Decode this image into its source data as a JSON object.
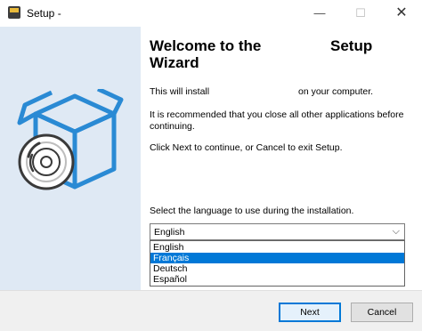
{
  "window": {
    "title": "Setup -",
    "minimize_glyph": "—",
    "maximize_glyph": "☐",
    "close_glyph": "✕"
  },
  "wizard": {
    "heading_part1": "Welcome to the",
    "heading_part2": "Setup",
    "heading_part3": "Wizard",
    "install_before": "This will install",
    "install_after": "on your computer.",
    "recommend": "It is recommended that you close all other applications before continuing.",
    "continue_text": "Click Next to continue, or Cancel to exit Setup.",
    "language_prompt": "Select the language to use during the installation."
  },
  "language": {
    "selected_value": "English",
    "options": [
      "English",
      "Français",
      "Deutsch",
      "Español"
    ],
    "highlighted_option": "Français"
  },
  "buttons": {
    "next": "Next",
    "cancel": "Cancel"
  },
  "colors": {
    "panel": "#dfe9f4",
    "accent": "#0078d7",
    "icon_blue": "#2a8ad4"
  },
  "icons": {
    "app": "setup-app-icon",
    "art": "software-box-disc-illustration",
    "chevron": "chevron-down-icon"
  }
}
